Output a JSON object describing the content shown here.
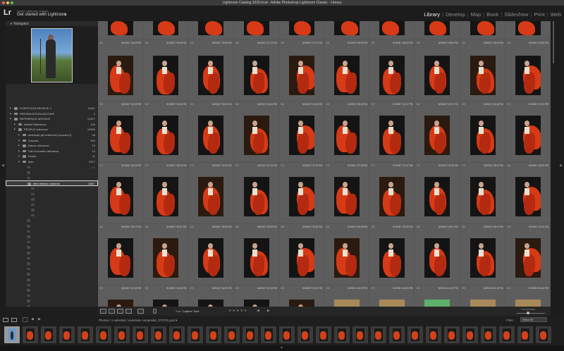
{
  "window": {
    "title": "Lightroom Catalog 2020.lrcat - Adobe Photoshop Lightroom Classic - Library"
  },
  "identity": {
    "logo": "Lr",
    "subtitle": "Adobe Lightroom Classic",
    "tagline": "Get started with Lightroom",
    "caret": "▸"
  },
  "modules": [
    {
      "label": "Library",
      "active": true
    },
    {
      "label": "Develop"
    },
    {
      "label": "Map"
    },
    {
      "label": "Book"
    },
    {
      "label": "Slideshow"
    },
    {
      "label": "Print"
    },
    {
      "label": "Web"
    }
  ],
  "navigator": {
    "title": "Navigator",
    "collapse_icon": "triangle-down-icon"
  },
  "folders": [
    {
      "label": "PORTFOLIO ARCHIVE 1",
      "count": "11461",
      "indent": 1,
      "dim": false
    },
    {
      "label": "PRESENTATION ARCHIVE",
      "count": "9",
      "indent": 1,
      "dim": false
    },
    {
      "label": "REFERENCE ARCHIVE",
      "count": "19427",
      "indent": 1,
      "dim": false
    },
    {
      "label": "Artistic Reference",
      "count": "109",
      "indent": 2,
      "dim": false
    },
    {
      "label": "PEOPLE reference",
      "count": "10956",
      "indent": 2,
      "dim": false
    },
    {
      "label": "american girl reference (covered f)",
      "count": "98",
      "indent": 3,
      "dim": false
    },
    {
      "label": "Couples",
      "count": "590",
      "indent": 3,
      "dim": false
    },
    {
      "label": "Dance reference",
      "count": "20",
      "indent": 3,
      "dim": false
    },
    {
      "label": "Fall of modern reference",
      "count": "13",
      "indent": 3,
      "dim": false
    },
    {
      "label": "Kendo",
      "count": "11",
      "indent": 3,
      "dim": false
    },
    {
      "label": "Men",
      "count": "3317",
      "indent": 3,
      "dim": false
    },
    {
      "label": "",
      "count": "128",
      "indent": 4,
      "dim": true
    },
    {
      "label": "",
      "count": "",
      "indent": 4,
      "dim": true
    },
    {
      "label": "",
      "count": "",
      "indent": 4,
      "dim": true
    },
    {
      "label": "Men historic costume",
      "count": "2467",
      "indent": 4,
      "dim": false,
      "selected": true
    },
    {
      "label": "",
      "count": "",
      "indent": 5,
      "dim": true
    },
    {
      "label": "",
      "count": "",
      "indent": 5,
      "dim": true
    },
    {
      "label": "",
      "count": "",
      "indent": 5,
      "dim": true
    },
    {
      "label": "",
      "count": "",
      "indent": 5,
      "dim": true
    },
    {
      "label": "",
      "count": "",
      "indent": 5,
      "dim": true
    },
    {
      "label": "",
      "count": "",
      "indent": 5,
      "dim": true
    },
    {
      "label": "",
      "count": "",
      "indent": 4,
      "dim": true
    },
    {
      "label": "",
      "count": "",
      "indent": 4,
      "dim": true
    },
    {
      "label": "",
      "count": "",
      "indent": 4,
      "dim": true
    },
    {
      "label": "",
      "count": "",
      "indent": 4,
      "dim": true
    },
    {
      "label": "",
      "count": "",
      "indent": 4,
      "dim": true
    },
    {
      "label": "",
      "count": "",
      "indent": 4,
      "dim": true
    },
    {
      "label": "",
      "count": "",
      "indent": 4,
      "dim": true
    },
    {
      "label": "",
      "count": "",
      "indent": 4,
      "dim": true
    },
    {
      "label": "",
      "count": "",
      "indent": 4,
      "dim": true
    },
    {
      "label": "",
      "count": "",
      "indent": 4,
      "dim": true
    },
    {
      "label": "",
      "count": "",
      "indent": 4,
      "dim": true
    },
    {
      "label": "",
      "count": "",
      "indent": 4,
      "dim": true
    },
    {
      "label": "",
      "count": "",
      "indent": 4,
      "dim": true
    },
    {
      "label": "",
      "count": "",
      "indent": 4,
      "dim": true
    },
    {
      "label": "",
      "count": "",
      "indent": 4,
      "dim": true
    },
    {
      "label": "",
      "count": "",
      "indent": 4,
      "dim": true
    },
    {
      "label": "",
      "count": "",
      "indent": 4,
      "dim": true
    }
  ],
  "grid": {
    "rows": [
      {
        "indices": [
          "151",
          "152",
          "153",
          "154",
          "155",
          "156",
          "157",
          "158",
          "159",
          "160"
        ],
        "times": [
          "8/19/06 7:26:49 PM",
          "8/19/06 7:26:53 PM",
          "8/19/06 7:26:58 PM",
          "8/19/06 7:27:11 PM",
          "8/19/06 7:27:47 PM",
          "8/19/06 7:28:00 PM",
          "8/19/06 7:28:00 PM",
          "8/19/06 7:28:04 PM",
          "8/19/06 7:29:04 PM",
          "8/19/06 7:29:49 PM"
        ]
      },
      {
        "indices": [
          "161",
          "162",
          "163",
          "164",
          "165",
          "166",
          "167",
          "168",
          "169",
          "170"
        ],
        "times": [
          "8/19/06 7:30:49 PM",
          "8/19/06 7:30:49 PM",
          "8/19/06 7:30:49 PM",
          "8/19/06 7:30:41 PM",
          "8/19/06 7:30:49 PM",
          "8/19/06 7:30:49 PM",
          "8/19/06 7:31:17 PM",
          "8/19/06 7:32:31 PM",
          "8/19/06 7:33:18 PM",
          "8/19/06 7:33:22 PM"
        ]
      },
      {
        "indices": [
          "171",
          "172",
          "173",
          "174",
          "175",
          "176",
          "177",
          "178",
          "179",
          "180"
        ],
        "times": [
          "8/19/06 7:35:20 PM",
          "8/19/06 7:35:20 PM",
          "8/19/06 7:37:00 PM",
          "8/19/06 7:37:02 PM",
          "8/19/06 7:37:33 PM",
          "8/19/06 7:37:38 PM",
          "8/19/06 7:37:47 PM",
          "8/19/06 7:37:48 PM",
          "8/19/06 7:38:21 PM",
          "8/19/06 7:38:23 PM"
        ]
      },
      {
        "indices": [
          "181",
          "182",
          "183",
          "184",
          "185",
          "186",
          "187",
          "188",
          "189",
          "190"
        ],
        "times": [
          "8/19/06 7:39:17 PM",
          "8/19/06 7:39:21 PM",
          "8/19/06 7:39:25 PM",
          "8/19/06 7:39:33 PM",
          "8/19/06 7:39:33 PM",
          "8/19/06 7:39:36 PM",
          "8/19/06 7:39:39 PM",
          "8/19/06 7:40:01 PM",
          "8/19/06 7:40:17 PM",
          "8/19/06 7:40:31 PM"
        ]
      },
      {
        "indices": [
          "191",
          "192",
          "193",
          "194",
          "195",
          "196",
          "197",
          "198",
          "199",
          "200"
        ],
        "times": [
          "8/19/06 7:41:44 PM",
          "8/19/06 7:41:46 PM",
          "8/19/06 7:41:50 PM",
          "8/19/06 7:41:54 PM",
          "8/19/06 7:43:01 PM",
          "8/20/06 4:44:00 PM",
          "8/20/06 4:44:00 PM",
          "8/20/06 4:44:22 PM",
          "8/20/06 5:01:46 PM",
          "8/20/06 5:01:49 PM"
        ]
      }
    ]
  },
  "toolbar": {
    "sort_prefix": "Sort:",
    "sort_value": "Capture Time",
    "stars": "★★★★★",
    "thumbnails_label": "Thumbnails"
  },
  "filmstrip_bar": {
    "path": "Photos / 1 selected / seminole composite_070731.psd ▾",
    "filter_label": "Filter :",
    "filter_value": "Filters Off"
  },
  "colors": {
    "accent_cape": "#d63a16",
    "grid_bg": "#6f6f6f",
    "panel_bg": "#2a2a2a"
  },
  "icons": [
    "triangle-down-icon",
    "folder-icon",
    "grid-view-icon",
    "loupe-view-icon",
    "compare-view-icon",
    "survey-view-icon",
    "spray-can-icon",
    "play-icon",
    "arrow-right-icon",
    "arrow-left-icon"
  ]
}
